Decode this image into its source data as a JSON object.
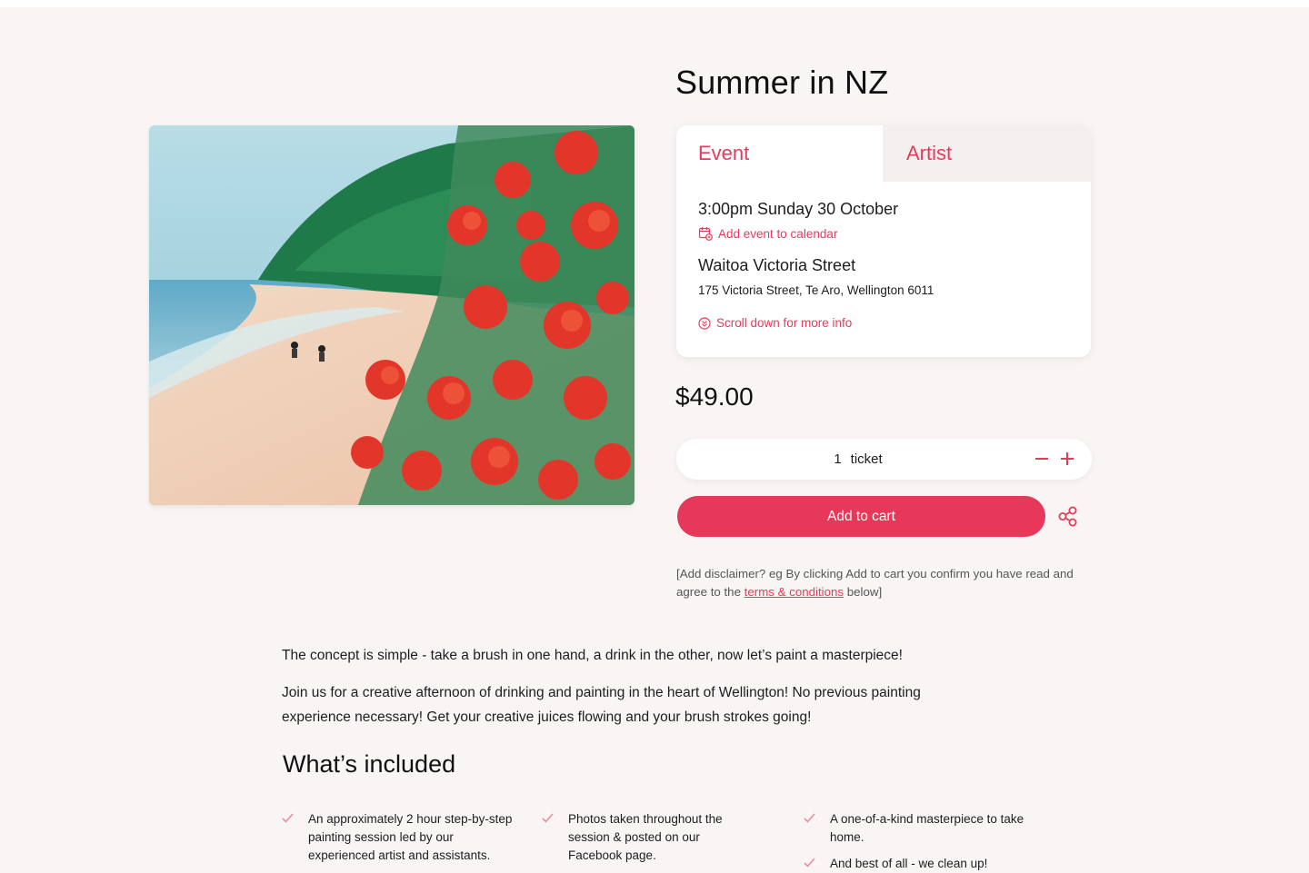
{
  "event": {
    "title": "Summer in NZ",
    "tabs": [
      "Event",
      "Artist"
    ],
    "datetime": "3:00pm Sunday 30 October",
    "add_calendar_label": "Add event to calendar",
    "venue": "Waitoa Victoria Street",
    "address": "175 Victoria Street, Te Aro, Wellington 6011",
    "scroll_label": "Scroll down for more info"
  },
  "price": "$49.00",
  "quantity": {
    "value": "1",
    "unit": "ticket"
  },
  "cart": {
    "add_label": "Add to cart"
  },
  "disclaimer": {
    "before": "[Add disclaimer? eg By clicking Add to cart you confirm you have read and agree to the ",
    "link": "terms & conditions",
    "after": " below]"
  },
  "description": [
    "The concept is simple - take a brush in one hand, a drink in the other, now let’s paint a masterpiece!",
    "Join us for a creative afternoon of drinking and painting in the heart of Wellington! No previous painting experience necessary! Get your creative juices flowing and your brush strokes going!"
  ],
  "included": {
    "title": "What’s included",
    "items": [
      "An approximately 2 hour step-by-step painting session led by our experienced artist and assistants.",
      "Photos taken throughout the session & posted on our Facebook page.",
      "A one-of-a-kind masterpiece to take home.",
      "And best of all - we clean up!"
    ]
  },
  "colors": {
    "accent": "#e8385a",
    "background": "#f9f5f5"
  },
  "icons": [
    "calendar-icon",
    "scroll-down-icon",
    "minus-icon",
    "plus-icon",
    "share-icon",
    "check-icon"
  ]
}
